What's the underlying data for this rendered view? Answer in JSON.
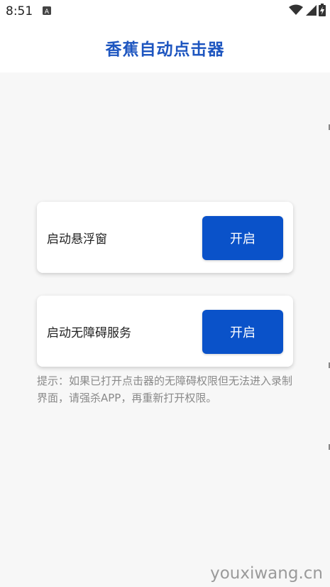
{
  "status_bar": {
    "time": "8:51",
    "notification_icon": "a-letter-notification-icon",
    "wifi_icon": "wifi-icon",
    "signal_icon": "signal-icon",
    "battery_icon": "battery-charging-icon"
  },
  "header": {
    "title": "香蕉自动点击器"
  },
  "cards": [
    {
      "label": "启动悬浮窗",
      "button_label": "开启"
    },
    {
      "label": "启动无障碍服务",
      "button_label": "开启"
    }
  ],
  "tip": "提示：如果已打开点击器的无障碍权限但无法进入录制界面，请强杀APP，再重新打开权限。",
  "watermark": "youxiwang.cn",
  "colors": {
    "accent": "#0a52c9",
    "title": "#1e56c0",
    "background": "#f7f7f7",
    "tip_text": "#8a8a8a"
  }
}
